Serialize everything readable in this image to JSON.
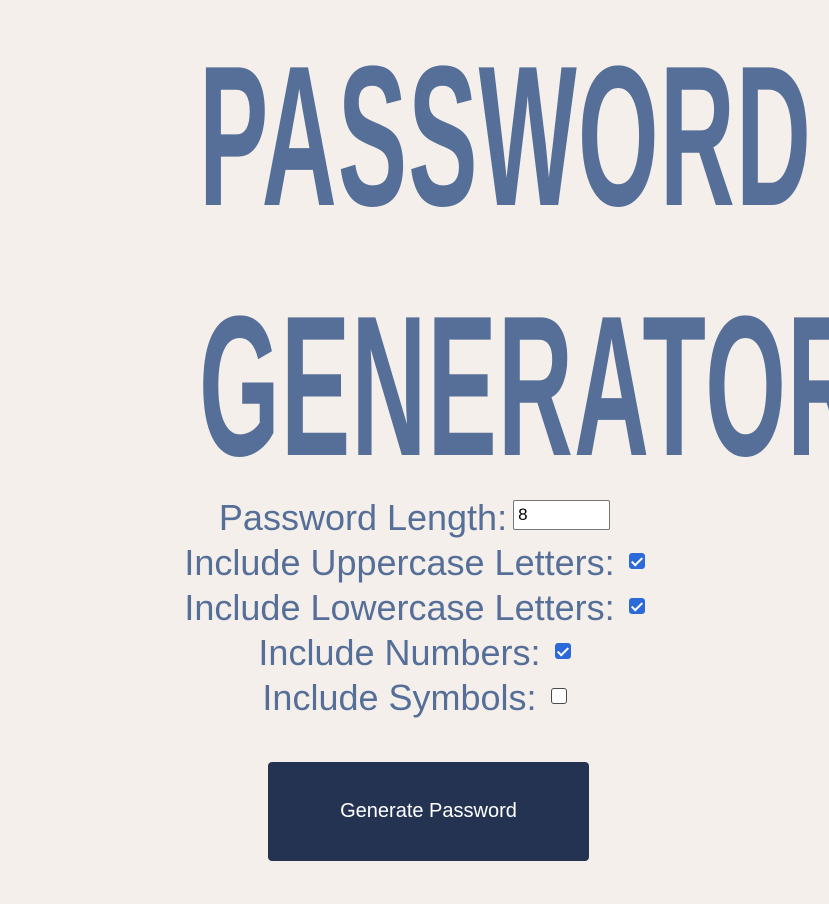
{
  "title": {
    "line1": "PASSWORD",
    "line2": "GENERATOR"
  },
  "options": {
    "length_label": "Password Length:",
    "length_value": "8",
    "uppercase_label": "Include Uppercase Letters:",
    "uppercase_checked": true,
    "lowercase_label": "Include Lowercase Letters:",
    "lowercase_checked": true,
    "numbers_label": "Include Numbers:",
    "numbers_checked": true,
    "symbols_label": "Include Symbols:",
    "symbols_checked": false
  },
  "button": {
    "generate_label": "Generate Password"
  },
  "colors": {
    "background": "#f4efea",
    "title": "#566f98",
    "button": "#243352",
    "checkbox_checked": "#2c6ad9"
  }
}
